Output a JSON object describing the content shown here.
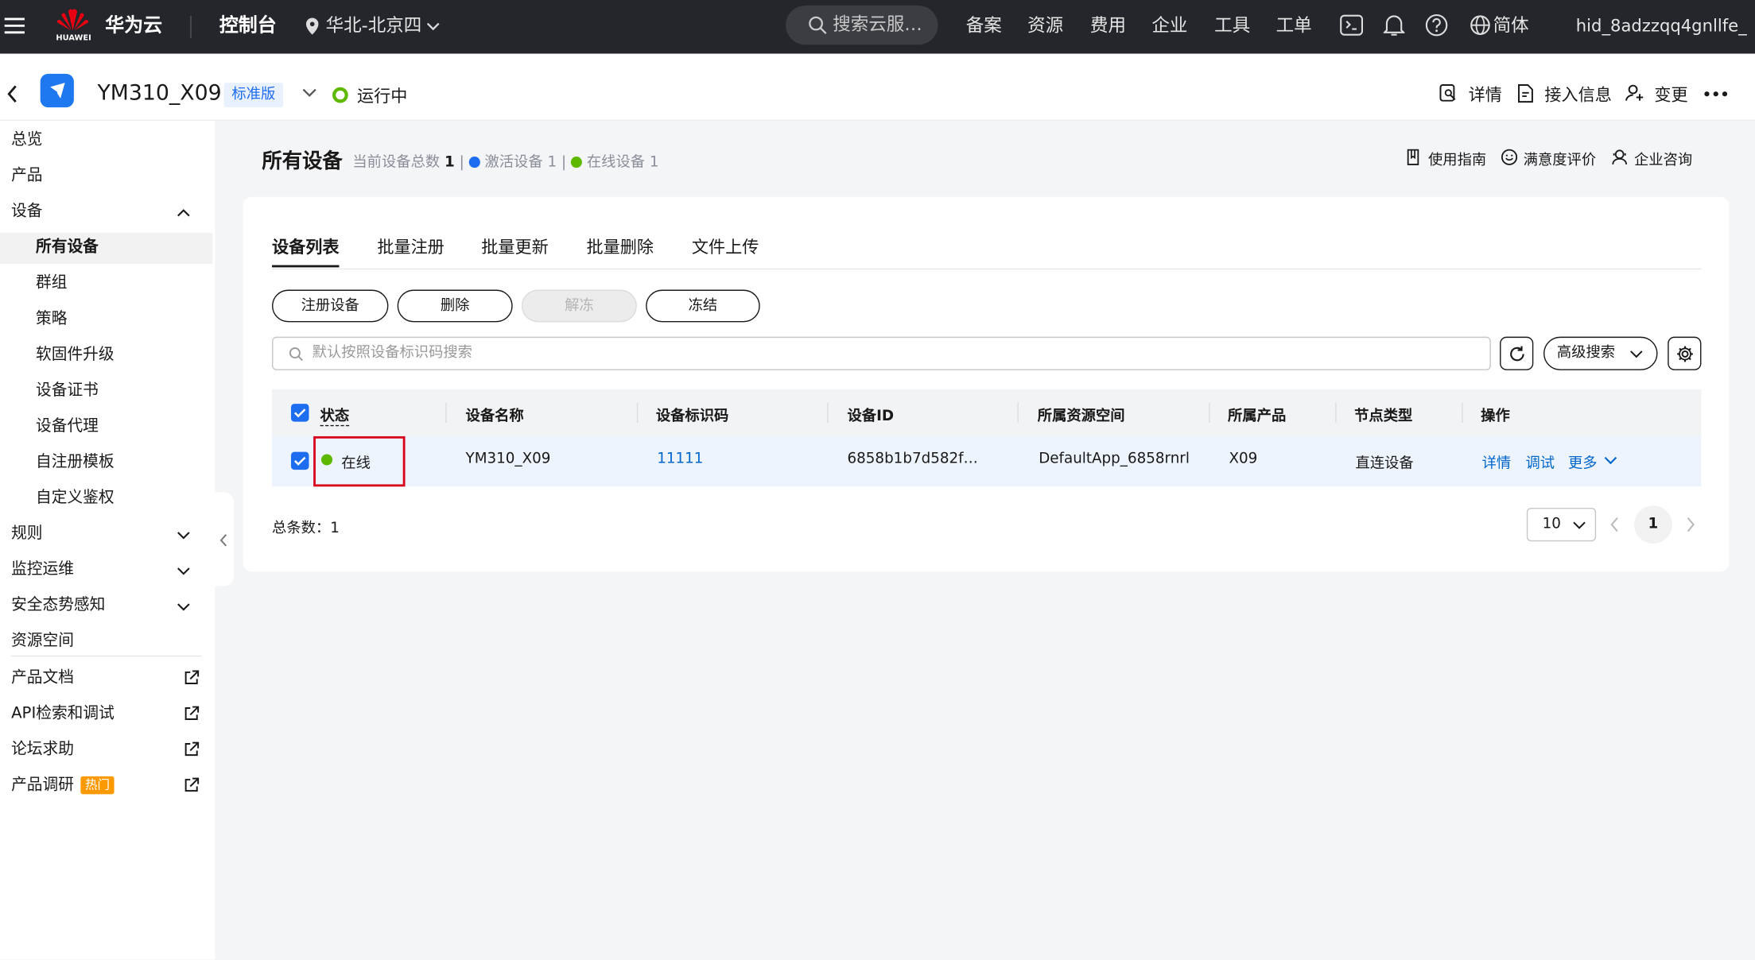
{
  "topbar": {
    "brand": "华为云",
    "logo_sub": "HUAWEI",
    "console": "控制台",
    "region": "华北-北京四",
    "search_placeholder": "搜索云服…",
    "nav": [
      "备案",
      "资源",
      "费用",
      "企业",
      "工具",
      "工单"
    ],
    "lang": "简体",
    "user": "hid_8adzzqq4gnllfe_"
  },
  "instance": {
    "name": "YM310_X09",
    "edition": "标准版",
    "status": "运行中",
    "actions": [
      "详情",
      "接入信息",
      "变更"
    ]
  },
  "sidebar": {
    "items": [
      "总览",
      "产品",
      "设备",
      "所有设备",
      "群组",
      "策略",
      "软固件升级",
      "设备证书",
      "设备代理",
      "自注册模板",
      "自定义鉴权",
      "规则",
      "监控运维",
      "安全态势感知",
      "资源空间",
      "产品文档",
      "API检索和调试",
      "论坛求助",
      "产品调研"
    ],
    "hot_badge": "热门"
  },
  "page": {
    "title": "所有设备",
    "stats_total_label": "当前设备总数",
    "stats_total": "1",
    "stats_active_label": "激活设备",
    "stats_active": "1",
    "stats_online_label": "在线设备",
    "stats_online": "1",
    "help_links": [
      "使用指南",
      "满意度评价",
      "企业咨询"
    ]
  },
  "tabs": [
    "设备列表",
    "批量注册",
    "批量更新",
    "批量删除",
    "文件上传"
  ],
  "buttons": [
    "注册设备",
    "删除",
    "解冻",
    "冻结"
  ],
  "search": {
    "placeholder": "默认按照设备标识码搜索",
    "advanced": "高级搜索"
  },
  "table": {
    "headers": [
      "状态",
      "设备名称",
      "设备标识码",
      "设备ID",
      "所属资源空间",
      "所属产品",
      "节点类型",
      "操作"
    ],
    "rows": [
      {
        "status": "在线",
        "name": "YM310_X09",
        "identifier": "11111",
        "device_id": "6858b1b7d582f…",
        "space": "DefaultApp_6858rnrl",
        "product": "X09",
        "node_type": "直连设备",
        "ops": [
          "详情",
          "调试",
          "更多"
        ]
      }
    ]
  },
  "pagination": {
    "total_label": "总条数：",
    "total": "1",
    "page_size": "10",
    "current": "1"
  },
  "colors": {
    "topbar": "#24262b",
    "link": "#0066cc",
    "online": "#5fb800",
    "active_dot": "#1e6cf0",
    "highlight": "#d9001b",
    "hot": "#ff9900"
  }
}
